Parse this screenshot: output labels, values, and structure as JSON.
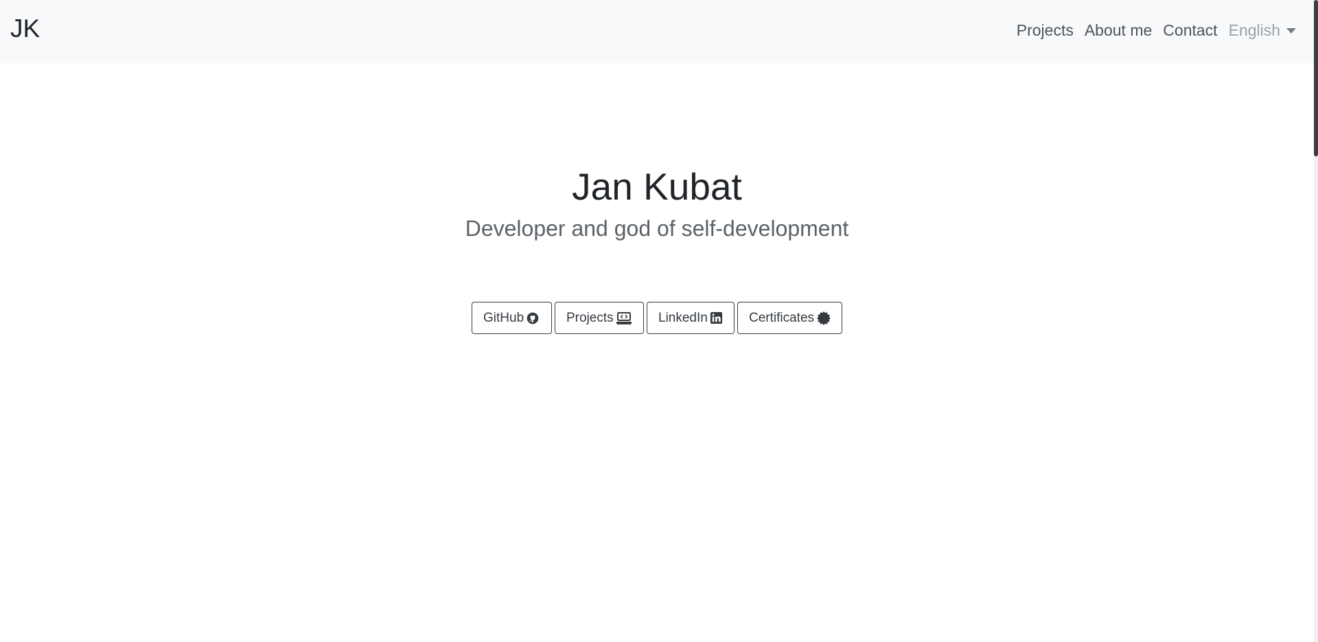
{
  "navbar": {
    "brand": "JK",
    "links": [
      {
        "label": "Projects"
      },
      {
        "label": "About me"
      },
      {
        "label": "Contact"
      }
    ],
    "language": {
      "selected": "English",
      "icon": "chevron-down-icon"
    }
  },
  "hero": {
    "title": "Jan Kubat",
    "subtitle": "Developer and god of self-development"
  },
  "buttons": [
    {
      "label": "GitHub",
      "icon": "github-icon"
    },
    {
      "label": "Projects",
      "icon": "laptop-code-icon"
    },
    {
      "label": "LinkedIn",
      "icon": "linkedin-icon"
    },
    {
      "label": "Certificates",
      "icon": "certificate-icon"
    }
  ],
  "colors": {
    "navbar_background": "#f8f9fa",
    "text": "#212529",
    "button_border": "#343a40"
  }
}
